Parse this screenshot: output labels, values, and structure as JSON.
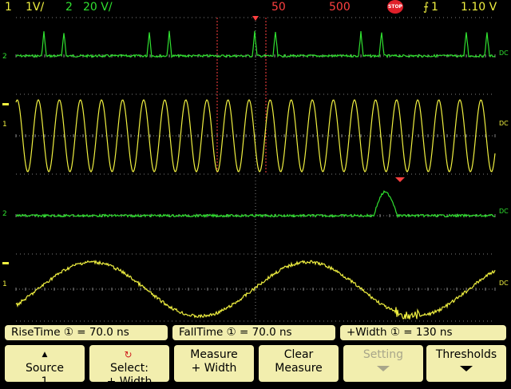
{
  "status": {
    "ch1_num": "1",
    "ch1_scale": "1V/",
    "ch2_num": "2",
    "ch2_scale": "20 V/",
    "time_delay": "50",
    "time_scale": "500",
    "run_state_icon": "stop-icon",
    "run_state_label": "STOP",
    "trigger_source": "1",
    "trigger_level": "1.10 V"
  },
  "channel_markers": {
    "ch1_label": "1",
    "ch2_label": "2",
    "coupling": "DC"
  },
  "measurements": [
    {
      "label": "RiseTime",
      "source_icon": "①",
      "value": "70.0 ns"
    },
    {
      "label": "FallTime",
      "source_icon": "①",
      "value": "70.0 ns"
    },
    {
      "label": "+Width",
      "source_icon": "①",
      "value": "130 ns"
    }
  ],
  "softkeys": [
    {
      "line1": "Source",
      "line2": "1"
    },
    {
      "line1": "Select:",
      "line2": "+ Width"
    },
    {
      "line1": "Measure",
      "line2": "+ Width"
    },
    {
      "line1": "Clear",
      "line2": "Measure"
    },
    {
      "line1": "Setting",
      "line2": ""
    },
    {
      "line1": "Thresholds",
      "line2": ""
    }
  ],
  "colors": {
    "ch1": "#f0f040",
    "ch2": "#30e030",
    "marker": "#ff4040",
    "grid": "#808080",
    "softkey_bg": "#f2eeae"
  }
}
